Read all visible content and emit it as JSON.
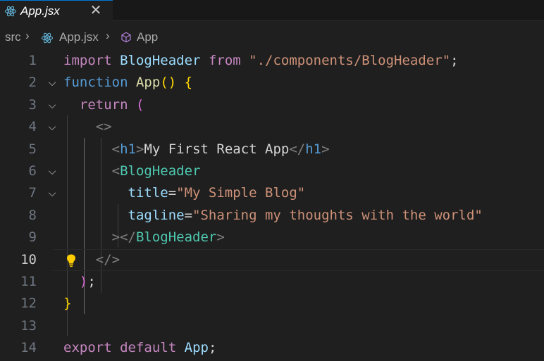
{
  "tab": {
    "filename": "App.jsx",
    "close_icon": "close-icon"
  },
  "breadcrumb": {
    "folder": "src",
    "file": "App.jsx",
    "symbol": "App"
  },
  "editor": {
    "current_line": 10,
    "lines": [
      {
        "number": "1",
        "tokens": [
          [
            "kw",
            "import"
          ],
          [
            "txt",
            " "
          ],
          [
            "attr",
            "BlogHeader"
          ],
          [
            "txt",
            " "
          ],
          [
            "kw",
            "from"
          ],
          [
            "txt",
            " "
          ],
          [
            "str",
            "\"./components/BlogHeader\""
          ],
          [
            "txt",
            ";"
          ]
        ]
      },
      {
        "number": "2",
        "tokens": [
          [
            "kw2",
            "function"
          ],
          [
            "txt",
            " "
          ],
          [
            "fn",
            "App"
          ],
          [
            "br1",
            "()"
          ],
          [
            "txt",
            " "
          ],
          [
            "br1",
            "{"
          ]
        ]
      },
      {
        "number": "3",
        "tokens": [
          [
            "txt",
            "  "
          ],
          [
            "kw",
            "return"
          ],
          [
            "txt",
            " "
          ],
          [
            "br2",
            "("
          ]
        ]
      },
      {
        "number": "4",
        "tokens": [
          [
            "txt",
            "    "
          ],
          [
            "tagp",
            "<>"
          ]
        ]
      },
      {
        "number": "5",
        "tokens": [
          [
            "txt",
            "      "
          ],
          [
            "tagp",
            "<"
          ],
          [
            "tag",
            "h1"
          ],
          [
            "tagp",
            ">"
          ],
          [
            "txt",
            "My First React App"
          ],
          [
            "tagp",
            "</"
          ],
          [
            "tag",
            "h1"
          ],
          [
            "tagp",
            ">"
          ]
        ]
      },
      {
        "number": "6",
        "tokens": [
          [
            "txt",
            "      "
          ],
          [
            "tagp",
            "<"
          ],
          [
            "cls",
            "BlogHeader"
          ]
        ]
      },
      {
        "number": "7",
        "tokens": [
          [
            "txt",
            "        "
          ],
          [
            "attr",
            "title"
          ],
          [
            "op",
            "="
          ],
          [
            "str",
            "\"My Simple Blog\""
          ]
        ]
      },
      {
        "number": "8",
        "tokens": [
          [
            "txt",
            "        "
          ],
          [
            "attr",
            "tagline"
          ],
          [
            "op",
            "="
          ],
          [
            "str",
            "\"Sharing my thoughts with the world\""
          ]
        ]
      },
      {
        "number": "9",
        "tokens": [
          [
            "txt",
            "      "
          ],
          [
            "tagp",
            "></"
          ],
          [
            "cls",
            "BlogHeader"
          ],
          [
            "tagp",
            ">"
          ]
        ]
      },
      {
        "number": "10",
        "tokens": [
          [
            "txt",
            "    "
          ],
          [
            "tagp",
            "</>"
          ]
        ]
      },
      {
        "number": "11",
        "tokens": [
          [
            "txt",
            "  "
          ],
          [
            "br2",
            ")"
          ],
          [
            "txt",
            ";"
          ]
        ]
      },
      {
        "number": "12",
        "tokens": [
          [
            "br1",
            "}"
          ]
        ]
      },
      {
        "number": "13",
        "tokens": []
      },
      {
        "number": "14",
        "tokens": [
          [
            "kw",
            "export"
          ],
          [
            "txt",
            " "
          ],
          [
            "kw",
            "default"
          ],
          [
            "txt",
            " "
          ],
          [
            "attr",
            "App"
          ],
          [
            "txt",
            ";"
          ]
        ]
      }
    ],
    "fold_markers": [
      "2",
      "3",
      "4",
      "6",
      "7"
    ]
  },
  "icons": {
    "file_icon": "react-icon",
    "symbol_icon": "symbol-class-icon",
    "lightbulb": "lightbulb-icon"
  },
  "colors": {
    "accent": "#0078d4",
    "background": "#1f1f1f"
  }
}
